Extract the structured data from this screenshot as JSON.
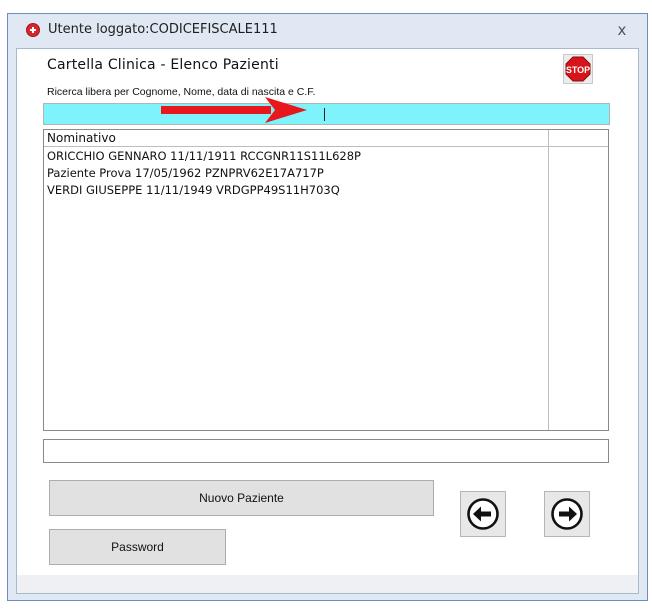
{
  "window": {
    "title": "Utente loggato:CODICEFISCALE111",
    "close_label": "x"
  },
  "form": {
    "title": "Cartella Clinica - Elenco Pazienti",
    "stop_label": "STOP"
  },
  "search": {
    "label": "Ricerca libera per Cognome, Nome, data di nascita e C.F.",
    "value": ""
  },
  "list": {
    "header": "Nominativo",
    "rows": [
      "ORICCHIO GENNARO 11/11/1911 RCCGNR11S11L628P",
      "Paziente Prova 17/05/1962 PZNPRV62E17A717P",
      "VERDI GIUSEPPE 11/11/1949 VRDGPP49S11H703Q"
    ]
  },
  "buttons": {
    "new_patient": "Nuovo Paziente",
    "password": "Password"
  },
  "colors": {
    "search_bg": "#7ff3fb",
    "annotation_arrow": "#e8171c",
    "stop_red": "#d7141a"
  },
  "icons": {
    "app": "medical-cross-icon",
    "stop": "stop-sign-icon",
    "back": "arrow-left-circle-icon",
    "forward": "arrow-right-circle-icon"
  }
}
